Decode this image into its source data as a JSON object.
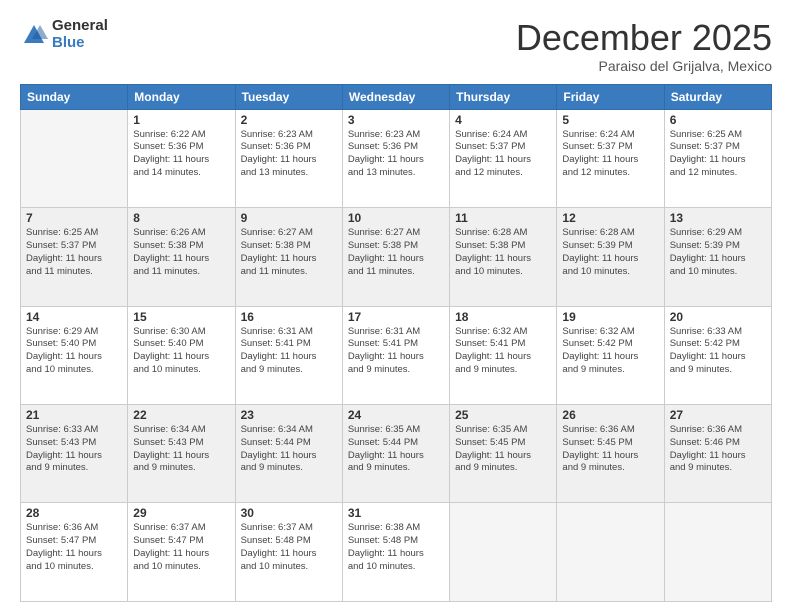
{
  "logo": {
    "general": "General",
    "blue": "Blue"
  },
  "header": {
    "month": "December 2025",
    "location": "Paraiso del Grijalva, Mexico"
  },
  "weekdays": [
    "Sunday",
    "Monday",
    "Tuesday",
    "Wednesday",
    "Thursday",
    "Friday",
    "Saturday"
  ],
  "weeks": [
    [
      {
        "day": "",
        "empty": true
      },
      {
        "day": "1",
        "sunrise": "6:22 AM",
        "sunset": "5:36 PM",
        "daylight": "11 hours and 14 minutes."
      },
      {
        "day": "2",
        "sunrise": "6:23 AM",
        "sunset": "5:36 PM",
        "daylight": "11 hours and 13 minutes."
      },
      {
        "day": "3",
        "sunrise": "6:23 AM",
        "sunset": "5:36 PM",
        "daylight": "11 hours and 13 minutes."
      },
      {
        "day": "4",
        "sunrise": "6:24 AM",
        "sunset": "5:37 PM",
        "daylight": "11 hours and 12 minutes."
      },
      {
        "day": "5",
        "sunrise": "6:24 AM",
        "sunset": "5:37 PM",
        "daylight": "11 hours and 12 minutes."
      },
      {
        "day": "6",
        "sunrise": "6:25 AM",
        "sunset": "5:37 PM",
        "daylight": "11 hours and 12 minutes."
      }
    ],
    [
      {
        "day": "7",
        "sunrise": "6:25 AM",
        "sunset": "5:37 PM",
        "daylight": "11 hours and 11 minutes."
      },
      {
        "day": "8",
        "sunrise": "6:26 AM",
        "sunset": "5:38 PM",
        "daylight": "11 hours and 11 minutes."
      },
      {
        "day": "9",
        "sunrise": "6:27 AM",
        "sunset": "5:38 PM",
        "daylight": "11 hours and 11 minutes."
      },
      {
        "day": "10",
        "sunrise": "6:27 AM",
        "sunset": "5:38 PM",
        "daylight": "11 hours and 11 minutes."
      },
      {
        "day": "11",
        "sunrise": "6:28 AM",
        "sunset": "5:38 PM",
        "daylight": "11 hours and 10 minutes."
      },
      {
        "day": "12",
        "sunrise": "6:28 AM",
        "sunset": "5:39 PM",
        "daylight": "11 hours and 10 minutes."
      },
      {
        "day": "13",
        "sunrise": "6:29 AM",
        "sunset": "5:39 PM",
        "daylight": "11 hours and 10 minutes."
      }
    ],
    [
      {
        "day": "14",
        "sunrise": "6:29 AM",
        "sunset": "5:40 PM",
        "daylight": "11 hours and 10 minutes."
      },
      {
        "day": "15",
        "sunrise": "6:30 AM",
        "sunset": "5:40 PM",
        "daylight": "11 hours and 10 minutes."
      },
      {
        "day": "16",
        "sunrise": "6:31 AM",
        "sunset": "5:41 PM",
        "daylight": "11 hours and 9 minutes."
      },
      {
        "day": "17",
        "sunrise": "6:31 AM",
        "sunset": "5:41 PM",
        "daylight": "11 hours and 9 minutes."
      },
      {
        "day": "18",
        "sunrise": "6:32 AM",
        "sunset": "5:41 PM",
        "daylight": "11 hours and 9 minutes."
      },
      {
        "day": "19",
        "sunrise": "6:32 AM",
        "sunset": "5:42 PM",
        "daylight": "11 hours and 9 minutes."
      },
      {
        "day": "20",
        "sunrise": "6:33 AM",
        "sunset": "5:42 PM",
        "daylight": "11 hours and 9 minutes."
      }
    ],
    [
      {
        "day": "21",
        "sunrise": "6:33 AM",
        "sunset": "5:43 PM",
        "daylight": "11 hours and 9 minutes."
      },
      {
        "day": "22",
        "sunrise": "6:34 AM",
        "sunset": "5:43 PM",
        "daylight": "11 hours and 9 minutes."
      },
      {
        "day": "23",
        "sunrise": "6:34 AM",
        "sunset": "5:44 PM",
        "daylight": "11 hours and 9 minutes."
      },
      {
        "day": "24",
        "sunrise": "6:35 AM",
        "sunset": "5:44 PM",
        "daylight": "11 hours and 9 minutes."
      },
      {
        "day": "25",
        "sunrise": "6:35 AM",
        "sunset": "5:45 PM",
        "daylight": "11 hours and 9 minutes."
      },
      {
        "day": "26",
        "sunrise": "6:36 AM",
        "sunset": "5:45 PM",
        "daylight": "11 hours and 9 minutes."
      },
      {
        "day": "27",
        "sunrise": "6:36 AM",
        "sunset": "5:46 PM",
        "daylight": "11 hours and 9 minutes."
      }
    ],
    [
      {
        "day": "28",
        "sunrise": "6:36 AM",
        "sunset": "5:47 PM",
        "daylight": "11 hours and 10 minutes."
      },
      {
        "day": "29",
        "sunrise": "6:37 AM",
        "sunset": "5:47 PM",
        "daylight": "11 hours and 10 minutes."
      },
      {
        "day": "30",
        "sunrise": "6:37 AM",
        "sunset": "5:48 PM",
        "daylight": "11 hours and 10 minutes."
      },
      {
        "day": "31",
        "sunrise": "6:38 AM",
        "sunset": "5:48 PM",
        "daylight": "11 hours and 10 minutes."
      },
      {
        "day": "",
        "empty": true
      },
      {
        "day": "",
        "empty": true
      },
      {
        "day": "",
        "empty": true
      }
    ]
  ]
}
